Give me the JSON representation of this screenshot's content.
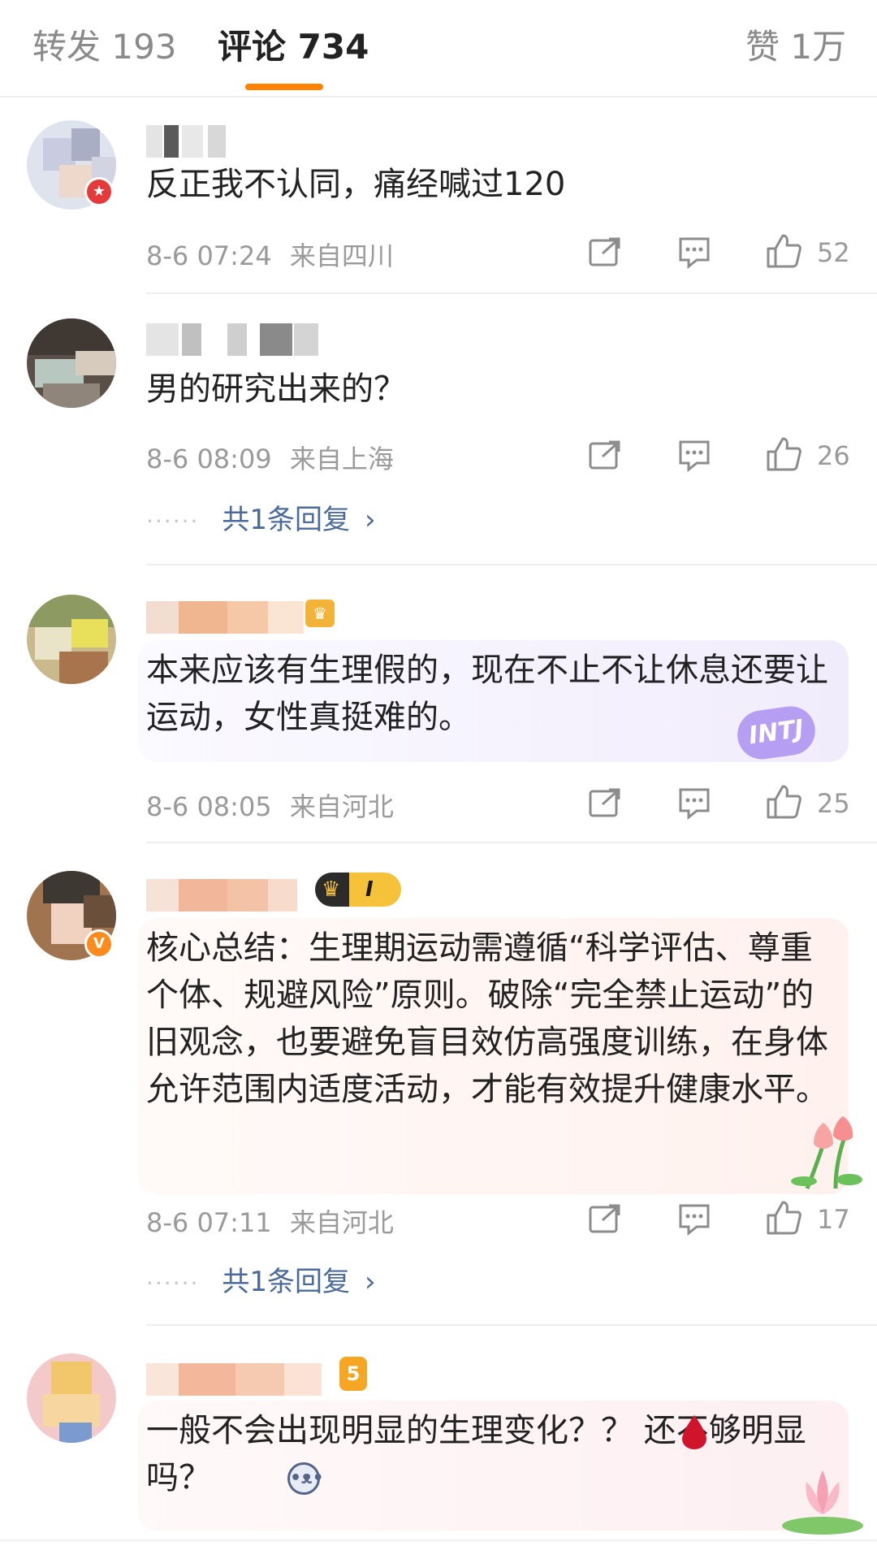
{
  "tabs": {
    "repost": "转发 193",
    "comments": "评论 734",
    "likes": "赞 1万"
  },
  "comments": [
    {
      "text": "反正我不认同，痛经喊过120",
      "time": "8-6 07:24",
      "location": "来自四川",
      "likes": "52"
    },
    {
      "text": "男的研究出来的？",
      "time": "8-6 08:09",
      "location": "来自上海",
      "likes": "26",
      "replies": "共1条回复"
    },
    {
      "text": "本来应该有生理假的，现在不止不让休息还要让运动，女性真挺难的。",
      "time": "8-6 08:05",
      "location": "来自河北",
      "likes": "25",
      "badge": "INTJ"
    },
    {
      "text": "核心总结：生理期运动需遵循“科学评估、尊重个体、规避风险”原则。破除“完全禁止运动”的旧观念，也要避免盲目效仿高强度训练，在身体允许范围内适度活动，才能有效提升健康水平。",
      "time": "8-6 07:11",
      "location": "来自河北",
      "likes": "17",
      "replies": "共1条回复",
      "badge": "I"
    },
    {
      "text": "一般不会出现明显的生理变化？？ 还不够明显吗？",
      "time": "",
      "location": "",
      "likes": "",
      "badge": "5"
    }
  ],
  "colors": {
    "accent": "#ff8200",
    "link": "#4a6b9b",
    "meta": "#9a9a9a"
  }
}
